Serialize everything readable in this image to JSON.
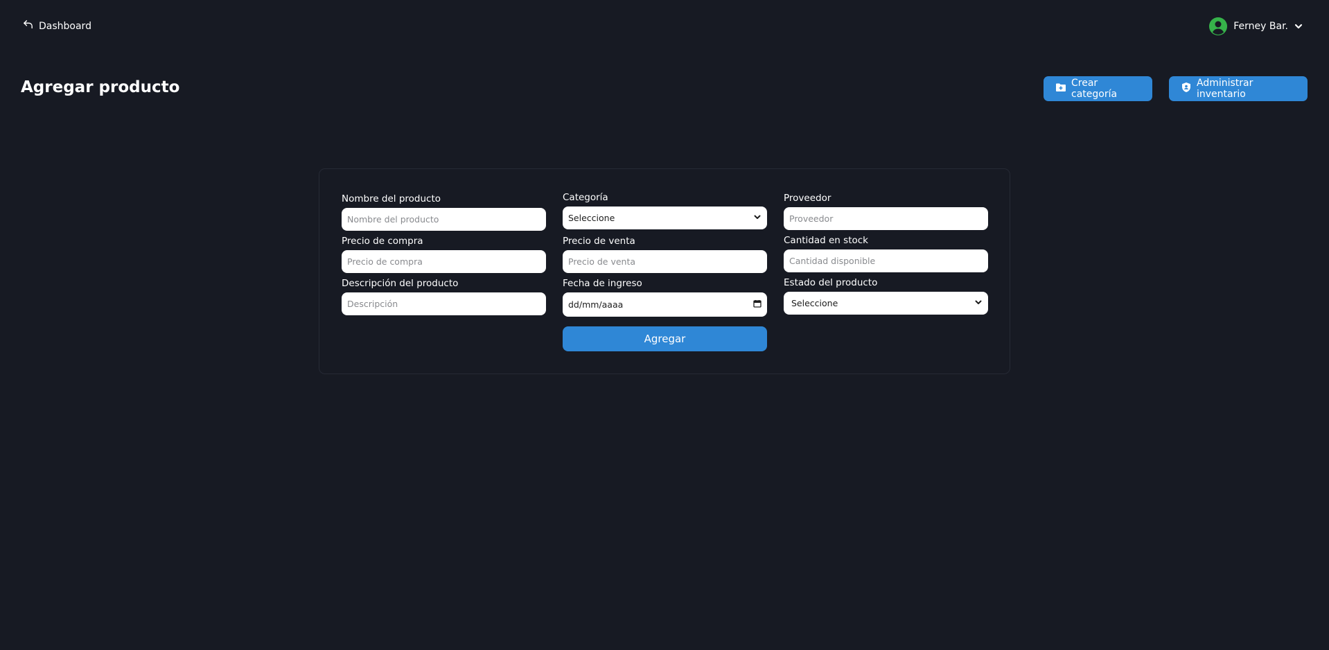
{
  "header": {
    "back_label": "Dashboard",
    "user_name": "Ferney Bar."
  },
  "page": {
    "title": "Agregar producto",
    "create_category_label": "Crear categoría",
    "manage_inventory_label": "Administrar inventario"
  },
  "form": {
    "product_name": {
      "label": "Nombre del producto",
      "placeholder": "Nombre del producto"
    },
    "category": {
      "label": "Categoría",
      "value": "Seleccione"
    },
    "supplier": {
      "label": "Proveedor",
      "placeholder": "Proveedor"
    },
    "purchase_price": {
      "label": "Precio de compra",
      "placeholder": "Precio de compra"
    },
    "sale_price": {
      "label": "Precio de venta",
      "placeholder": "Precio de venta"
    },
    "stock_quantity": {
      "label": "Cantidad en stock",
      "placeholder": "Cantidad disponible"
    },
    "description": {
      "label": "Descripción del producto",
      "placeholder": "Descripción"
    },
    "entry_date": {
      "label": "Fecha de ingreso",
      "value": "dd/mm/aaaa"
    },
    "status": {
      "label": "Estado del producto",
      "value": "Seleccione"
    },
    "submit_label": "Agregar"
  },
  "colors": {
    "background": "#171a23",
    "accent": "#2f87d6",
    "avatar": "#36b24a"
  }
}
